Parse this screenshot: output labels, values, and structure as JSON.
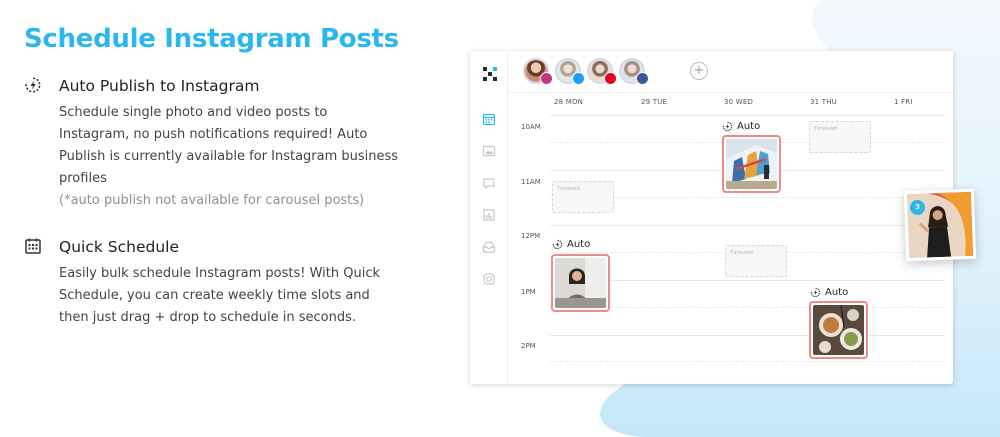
{
  "heading": {
    "title": "Schedule Instagram Posts"
  },
  "features": [
    {
      "icon": "auto-publish-icon",
      "heading": "Auto Publish to Instagram",
      "body": "Schedule single photo and video posts to Instagram, no push notifications required! Auto Publish is currently available for Instagram business profiles",
      "note": "(*auto publish not available for carousel posts)"
    },
    {
      "icon": "calendar-grid-icon",
      "heading": "Quick Schedule",
      "body": "Easily bulk schedule Instagram posts! With Quick Schedule, you can create weekly time slots and then just drag + drop to schedule in seconds."
    }
  ],
  "app": {
    "profiles": [
      {
        "network": "instagram",
        "badge_color": "#c13584"
      },
      {
        "network": "twitter",
        "badge_color": "#1da1f2"
      },
      {
        "network": "pinterest",
        "badge_color": "#e60023"
      },
      {
        "network": "facebook",
        "badge_color": "#3b5998"
      }
    ],
    "add_profile_label": "+",
    "days": [
      "28 MON",
      "29 TUE",
      "30 WED",
      "31 THU",
      "1 FRI"
    ],
    "times": [
      "10AM",
      "11AM",
      "12PM",
      "1PM",
      "2PM"
    ],
    "timeslot_label": "Timeslot",
    "auto_label": "Auto",
    "drag_count": "3",
    "colors": {
      "accent": "#2bb6f0",
      "post_border": "#f08a86"
    }
  }
}
